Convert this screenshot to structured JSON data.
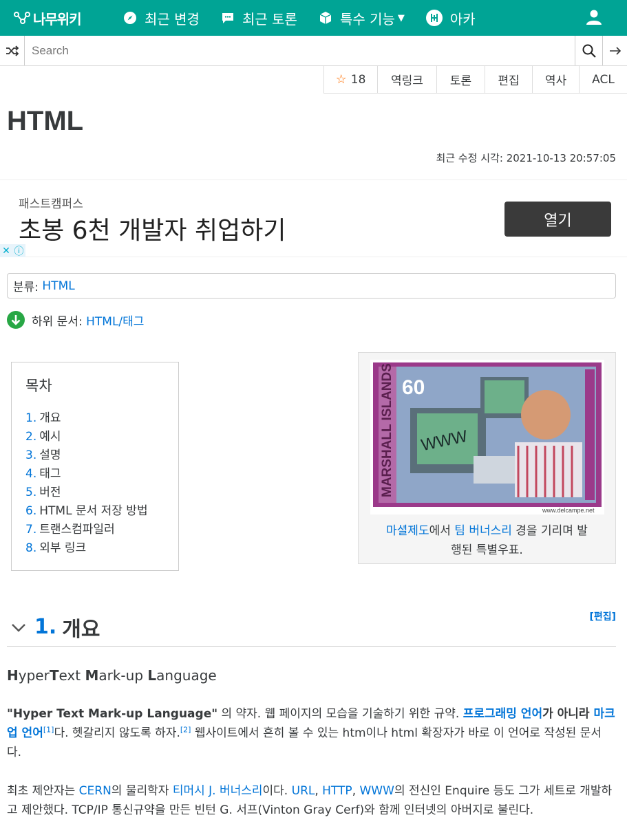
{
  "nav": {
    "logo_text": "나무위키",
    "items": [
      {
        "label": "최근 변경"
      },
      {
        "label": "최근 토론"
      },
      {
        "label": "특수 기능"
      },
      {
        "label": "아카"
      }
    ]
  },
  "search": {
    "placeholder": "Search"
  },
  "tools": {
    "star_count": "18",
    "backlinks": "역링크",
    "discuss": "토론",
    "edit": "편집",
    "history": "역사",
    "acl": "ACL"
  },
  "page": {
    "title": "HTML",
    "modified_label": "최근 수정 시각:",
    "modified_time": "2021-10-13 20:57:05"
  },
  "ad": {
    "brand": "패스트캠퍼스",
    "headline": "초봉 6천 개발자 취업하기",
    "cta": "열기",
    "close": "✕",
    "info": "ⓘ"
  },
  "category": {
    "label": "분류:",
    "value": "HTML"
  },
  "subdoc": {
    "label": "하위 문서:",
    "value": "HTML/태그"
  },
  "toc": {
    "title": "목차",
    "items": [
      {
        "num": "1.",
        "label": "개요"
      },
      {
        "num": "2.",
        "label": "예시"
      },
      {
        "num": "3.",
        "label": "설명"
      },
      {
        "num": "4.",
        "label": "태그"
      },
      {
        "num": "5.",
        "label": "버전"
      },
      {
        "num": "6.",
        "label": "HTML 문서 저장 방법"
      },
      {
        "num": "7.",
        "label": "트랜스컴파일러"
      },
      {
        "num": "8.",
        "label": "외부 링크"
      }
    ]
  },
  "figure": {
    "stamp_country": "MARSHALL ISLANDS",
    "stamp_value": "60",
    "stamp_www": "WWW",
    "stamp_site": "www.delcampe.net",
    "caption_link1": "마셜제도",
    "caption_t1": "에서 ",
    "caption_link2": "팀 버너스리",
    "caption_t2": " 경을 기리며 발",
    "caption_t3": "행된 특별우표."
  },
  "section": {
    "num": "1.",
    "title": "개요",
    "edit": "[편집]"
  },
  "content": {
    "acronym": {
      "h": "H",
      "yper": "yper",
      "t": "T",
      "ext": "ext ",
      "m": "M",
      "ark": "ark-up ",
      "l": "L",
      "anguage": "anguage"
    },
    "p2": {
      "bold": "\"Hyper Text Mark-up Language\"",
      "t1": " 의 약자. 웹 페이지의 모습을 기술하기 위한 규약. ",
      "link1": "프로그래밍 언어",
      "t2": "가 아니라 ",
      "link2": "마크업 언어",
      "sup1": "[1]",
      "t3": "다. 헷갈리지 않도록 하자.",
      "sup2": "[2]",
      "t4": " 웹사이트에서 흔히 볼 수 있는 htm이나 html 확장자가 바로 이 언어로 작성된 문서다."
    },
    "p3": {
      "t1": "최초 제안자는 ",
      "link1": "CERN",
      "t2": "의 물리학자 ",
      "link2": "티머시 J. 버너스리",
      "t3": "이다. ",
      "link3": "URL",
      "t4": ", ",
      "link4": "HTTP",
      "t5": ", ",
      "link5": "WWW",
      "t6": "의 전신인 Enquire 등도 그가 세트로 개발하고 제안했다. TCP/IP 통신규약을 만든 빈턴 G. 서프(Vinton Gray Cerf)와 함께 인터넷의 아버지로 불린다."
    }
  },
  "colors": {
    "brand": "#00a495",
    "link": "#0275d8",
    "star": "#ff6f00",
    "subdoc_icon": "#28a745"
  }
}
